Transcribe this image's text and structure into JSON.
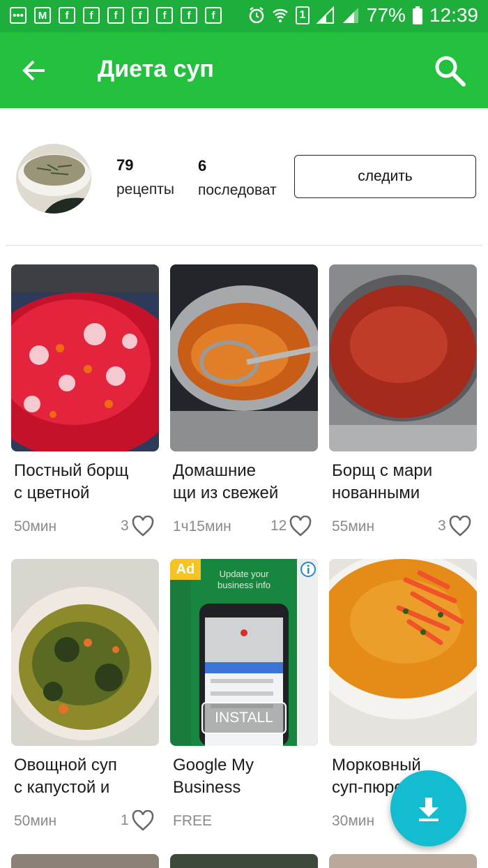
{
  "status": {
    "battery": "77%",
    "time": "12:39",
    "sim": "1"
  },
  "appbar": {
    "title": "Диета суп"
  },
  "profile": {
    "recipes_count": "79",
    "recipes_label": "рецепты",
    "followers_count": "6",
    "followers_label": "последоват",
    "follow_label": "следить"
  },
  "cards": [
    {
      "title1": "Постный борщ",
      "title2": "с цветной",
      "time": "50мин",
      "likes": "3"
    },
    {
      "title1": "Домашние",
      "title2": "щи из свежей",
      "time": "1ч15мин",
      "likes": "12"
    },
    {
      "title1": "Борщ с мари",
      "title2": "нованными",
      "time": "55мин",
      "likes": "3"
    },
    {
      "title1": "Овощной суп",
      "title2": "с капустой и",
      "time": "50мин",
      "likes": "1"
    },
    {
      "title1": "Google My",
      "title2": "Business",
      "time": "FREE",
      "likes": ""
    },
    {
      "title1": "Морковный",
      "title2": "суп-пюре",
      "time": "30мин",
      "likes": ""
    }
  ],
  "ad": {
    "badge": "Ad",
    "headline1": "Update your",
    "headline2": "business info",
    "install": "INSTALL"
  },
  "colors": {
    "statusbar": "#1eae3b",
    "appbar": "#22c03d",
    "fab": "#14bcd0",
    "ad_badge": "#f6c324"
  }
}
